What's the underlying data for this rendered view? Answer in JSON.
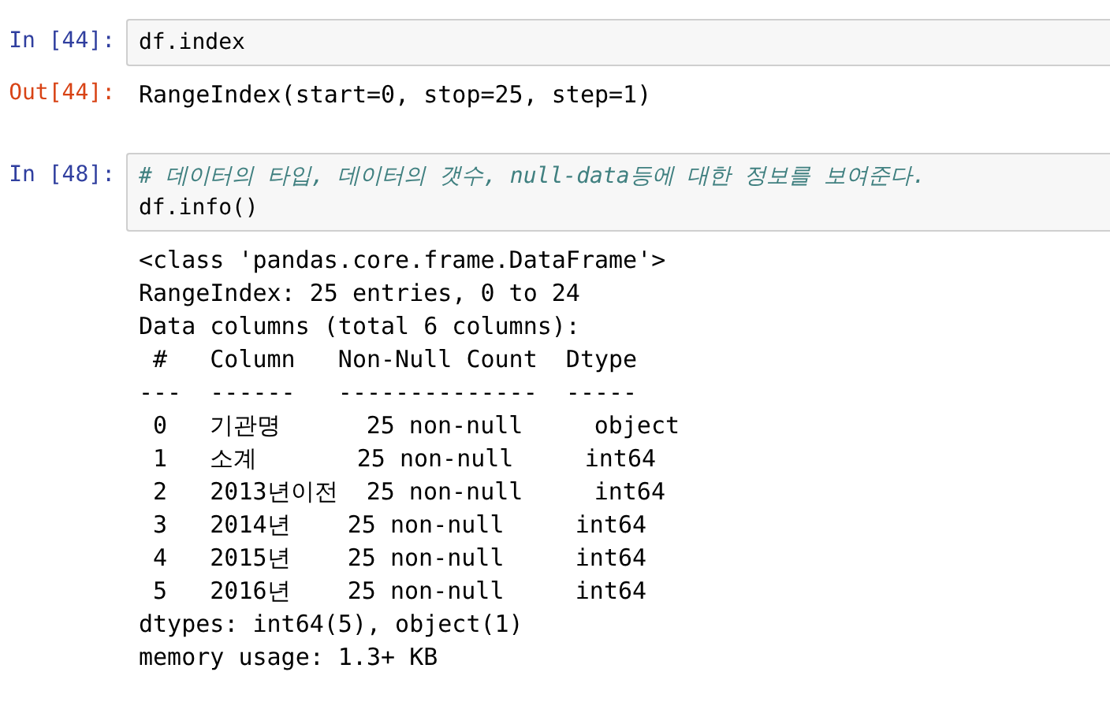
{
  "cells": [
    {
      "input_prompt": "In [44]:",
      "code": [
        {
          "kind": "code",
          "text": "df.index"
        }
      ],
      "output_prompt": "Out[44]:",
      "output": [
        "RangeIndex(start=0, stop=25, step=1)"
      ]
    },
    {
      "input_prompt": "In [48]:",
      "code": [
        {
          "kind": "comment",
          "text": "# 데이터의 타입, 데이터의 갯수, null-data등에 대한 정보를 보여준다."
        },
        {
          "kind": "code",
          "text": "df.info()"
        }
      ],
      "output": [
        "<class 'pandas.core.frame.DataFrame'>",
        "RangeIndex: 25 entries, 0 to 24",
        "Data columns (total 6 columns):",
        " #   Column   Non-Null Count  Dtype",
        "---  ------   --------------  -----",
        " 0   기관명      25 non-null     object",
        " 1   소계       25 non-null     int64",
        " 2   2013년이전  25 non-null     int64",
        " 3   2014년    25 non-null     int64",
        " 4   2015년    25 non-null     int64",
        " 5   2016년    25 non-null     int64",
        "dtypes: int64(5), object(1)",
        "memory usage: 1.3+ KB"
      ]
    }
  ]
}
